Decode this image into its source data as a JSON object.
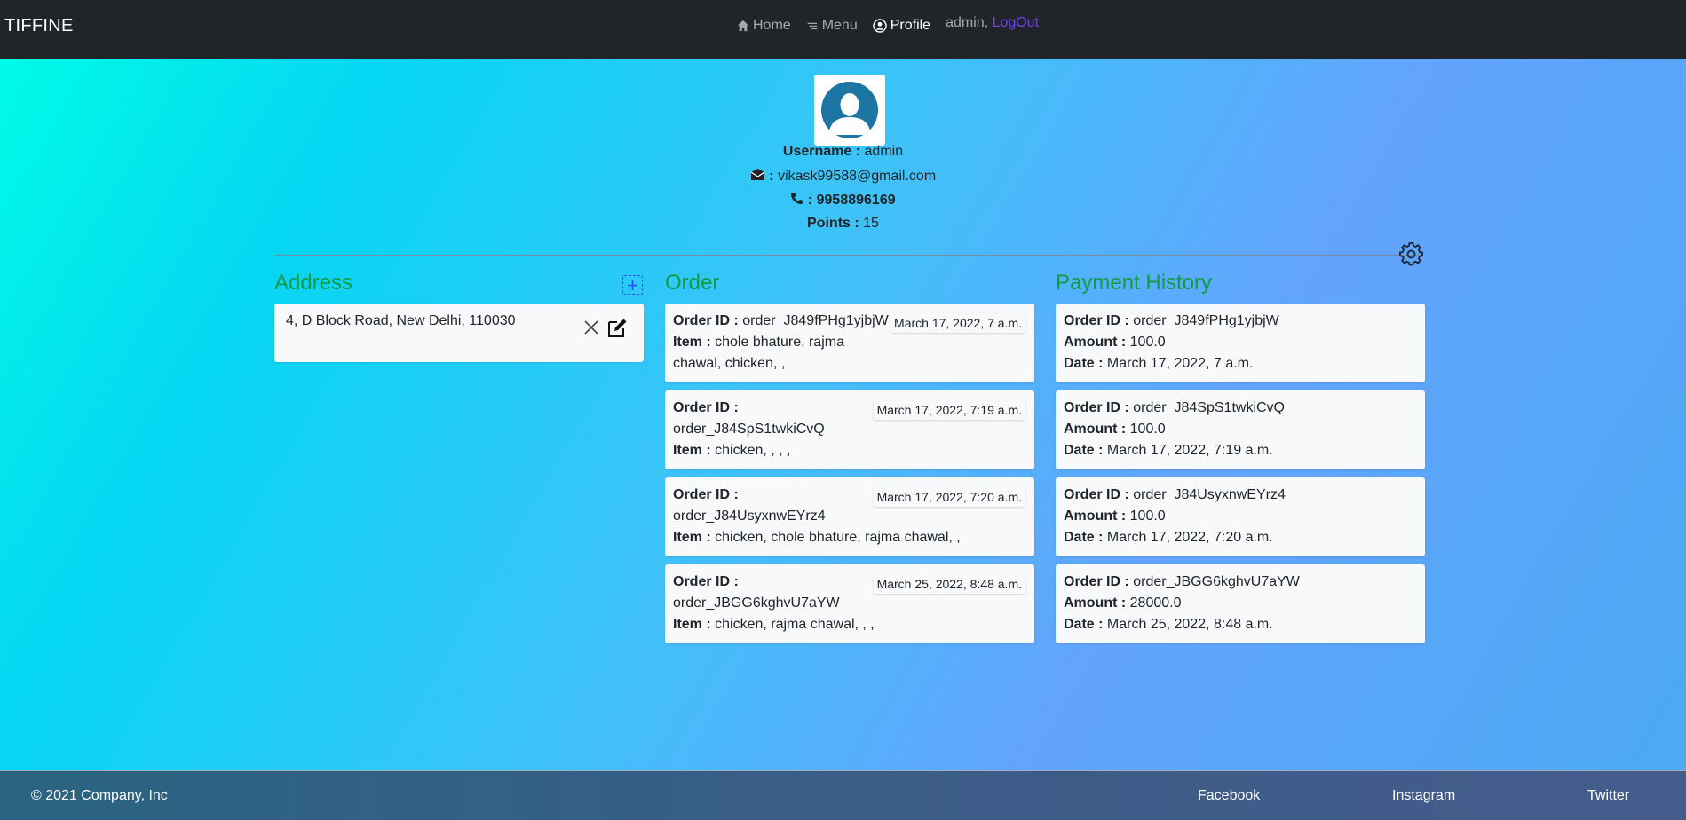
{
  "nav": {
    "brand": "TIFFINE",
    "links": [
      {
        "label": "Home",
        "icon": "home-icon"
      },
      {
        "label": "Menu",
        "icon": "menu-icon"
      },
      {
        "label": "Profile",
        "icon": "user-circle-icon"
      }
    ],
    "user_prefix": "admin,",
    "logout_label": "LogOut"
  },
  "profile": {
    "username_label": "Username :",
    "username": "admin",
    "email_label": ":",
    "email": "vikask99588@gmail.com",
    "phone_label": ":",
    "phone": "9958896169",
    "points_label": "Points :",
    "points": "15"
  },
  "address": {
    "title": "Address",
    "items": [
      "4, D Block Road, New Delhi, 110030"
    ]
  },
  "orders": {
    "title": "Order",
    "id_label": "Order ID :",
    "item_label": "Item :",
    "items": [
      {
        "id": "order_J849fPHg1yjbjW",
        "items_line1": "chole bhature, rajma",
        "items_line2": "chawal, chicken, ,",
        "date": "March 17, 2022, 7 a.m."
      },
      {
        "id": "order_J84SpS1twkiCvQ",
        "items": "chicken, , , ,",
        "date": "March 17, 2022, 7:19 a.m."
      },
      {
        "id": "order_J84UsyxnwEYrz4",
        "items": "chicken, chole bhature, rajma chawal, ,",
        "date": "March 17, 2022, 7:20 a.m."
      },
      {
        "id": "order_JBGG6kghvU7aYW",
        "items": "chicken, rajma chawal, , ,",
        "date": "March 25, 2022, 8:48 a.m."
      }
    ]
  },
  "payments": {
    "title": "Payment History",
    "id_label": "Order ID :",
    "amount_label": "Amount :",
    "date_label": "Date :",
    "items": [
      {
        "id": "order_J849fPHg1yjbjW",
        "amount": "100.0",
        "date": "March 17, 2022, 7 a.m."
      },
      {
        "id": "order_J84SpS1twkiCvQ",
        "amount": "100.0",
        "date": "March 17, 2022, 7:19 a.m."
      },
      {
        "id": "order_J84UsyxnwEYrz4",
        "amount": "100.0",
        "date": "March 17, 2022, 7:20 a.m."
      },
      {
        "id": "order_JBGG6kghvU7aYW",
        "amount": "28000.0",
        "date": "March 25, 2022, 8:48 a.m."
      }
    ]
  },
  "footer": {
    "copyright": "© 2021 Company, Inc",
    "links": [
      "Facebook",
      "Instagram",
      "Twitter"
    ]
  },
  "colors": {
    "navbar": "#212529",
    "section_title": "#119b47",
    "logout_link": "#6f42f1",
    "avatar": "#1c75a3"
  }
}
